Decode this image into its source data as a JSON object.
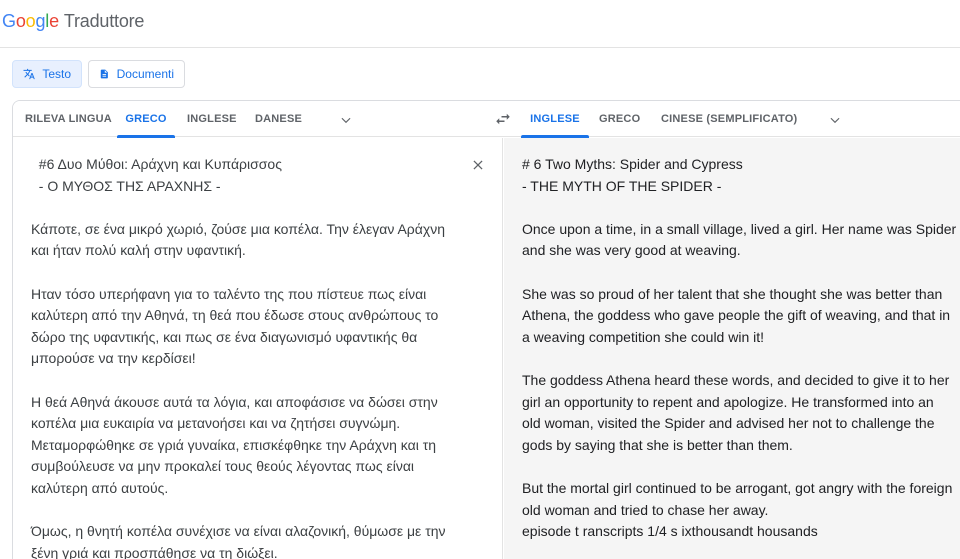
{
  "header": {
    "logo": [
      "G",
      "o",
      "o",
      "g",
      "l",
      "e"
    ],
    "product": "Traduttore"
  },
  "modes": {
    "text_label": "Testo",
    "docs_label": "Documenti"
  },
  "source_langs": [
    "RILEVA LINGUA",
    "GRECO",
    "INGLESE",
    "DANESE"
  ],
  "target_langs": [
    "INGLESE",
    "GRECO",
    "CINESE (SEMPLIFICATO)"
  ],
  "source": {
    "lines": [
      "  #6 Δυο Μύθοι: Αράχνη και Κυπάρισσος",
      "  - Ο ΜΥΘΟΣ ΤΗΣ ΑΡΑΧΝΗΣ -",
      "",
      "Κάποτε, σε ένα μικρό χωριό, ζούσε μια κοπέλα. Την έλεγαν Αράχνη",
      "και ήταν πολύ καλή στην υφαντική.",
      "",
      "Ηταν τόσο υπερήφανη για το ταλέντο της που πίστευε πως είναι",
      "καλύτερη από την Αθηνά, τη θεά που έδωσε στους ανθρώπους το",
      "δώρο της υφαντικής, και πως σε ένα διαγωνισμό υφαντικής θα",
      "μπορούσε να την κερδίσει!",
      "",
      "Η θεά Αθηνά άκουσε αυτά τα λόγια, και αποφάσισε να δώσει στην",
      "κοπέλα μια ευκαιρία να μετανοήσει και να ζητήσει συγνώμη.",
      "Μεταμορφώθηκε σε γριά γυναίκα, επισκέφθηκε την Αράχνη και τη",
      "συμβούλευσε να μην προκαλεί τους θεούς λέγοντας πως είναι",
      "καλύτερη από αυτούς.",
      "",
      "Όμως, η θνητή κοπέλα συνέχισε να είναι αλαζονική, θύμωσε με την",
      "ξένη γριά και προσπάθησε να τη διώξει."
    ]
  },
  "target": {
    "lines": [
      "# 6 Two Myths: Spider and Cypress",
      "- THE MYTH OF THE SPIDER -",
      "",
      "Once upon a time, in a small village, lived a girl. Her name was Spider",
      "and she was very good at weaving.",
      "",
      "She was so proud of her talent that she thought she was better than",
      "Athena, the goddess who gave people the gift of weaving, and that in",
      "a weaving competition she could win it!",
      "",
      "The goddess Athena heard these words, and decided to give it to her",
      "girl an opportunity to repent and apologize. He transformed into an",
      "old woman, visited the Spider and advised her not to challenge the",
      "gods by saying that she is better than them.",
      "",
      "But the mortal girl continued to be arrogant, got angry with the foreign",
      "old woman and tried to chase her away.",
      "episode t ranscripts 1/4 s ixthousandt housands"
    ]
  },
  "colors": {
    "accent": "#1a73e8",
    "accent_bg": "#e8f0fe",
    "target_bg": "#f5f5f5"
  }
}
